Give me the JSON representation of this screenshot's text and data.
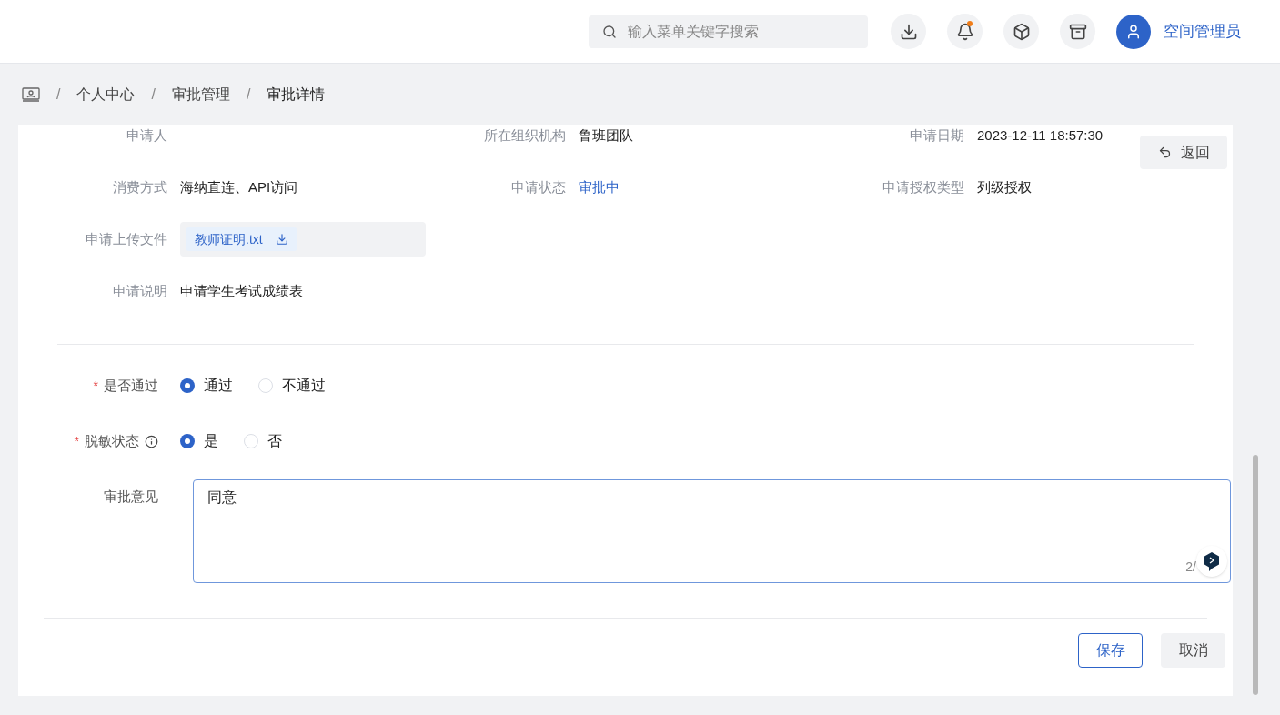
{
  "header": {
    "search": {
      "placeholder": "输入菜单关键字搜索"
    },
    "icons": [
      {
        "kind": "download",
        "badge": false
      },
      {
        "kind": "bell",
        "badge": true
      },
      {
        "kind": "cube",
        "badge": false
      },
      {
        "kind": "archive",
        "badge": false
      }
    ],
    "user": {
      "name": "空间管理员"
    }
  },
  "breadcrumb": {
    "separator": "/",
    "items": [
      "个人中心",
      "审批管理",
      "审批详情"
    ]
  },
  "details": [
    [
      {
        "label": "申请人",
        "kind": "text"
      },
      {
        "label": "所在组织机构",
        "value": "鲁班团队",
        "kind": "text"
      },
      {
        "label": "申请日期",
        "value": "2023-12-11 18:57:30",
        "kind": "text"
      }
    ],
    [
      {
        "label": "消费方式",
        "value": "海纳直连、API访问",
        "kind": "text"
      },
      {
        "label": "申请状态",
        "value": "审批中",
        "kind": "status"
      },
      {
        "label": "申请授权类型",
        "value": "列级授权",
        "kind": "text"
      }
    ],
    [
      {
        "label": "申请上传文件",
        "value": "教师证明.txt",
        "kind": "file"
      }
    ],
    [
      {
        "label": "申请说明",
        "value": "申请学生考试成绩表",
        "kind": "text"
      }
    ]
  ],
  "back_button": "返回",
  "form": {
    "required_mark": "*",
    "fields": [
      {
        "kind": "radio",
        "label": "是否通过",
        "required": true,
        "info": false,
        "options": [
          {
            "label": "通过",
            "selected": true
          },
          {
            "label": "不通过",
            "selected": false
          }
        ]
      },
      {
        "kind": "radio",
        "label": "脱敏状态",
        "required": true,
        "info": true,
        "options": [
          {
            "label": "是",
            "selected": true
          },
          {
            "label": "否",
            "selected": false
          }
        ]
      },
      {
        "kind": "textarea",
        "label": "审批意见",
        "required": false,
        "info": false,
        "value": "同意",
        "counter": "2/"
      }
    ]
  },
  "buttons": [
    {
      "label": "保存",
      "kind": "primary"
    },
    {
      "label": "取消",
      "kind": "default"
    }
  ]
}
